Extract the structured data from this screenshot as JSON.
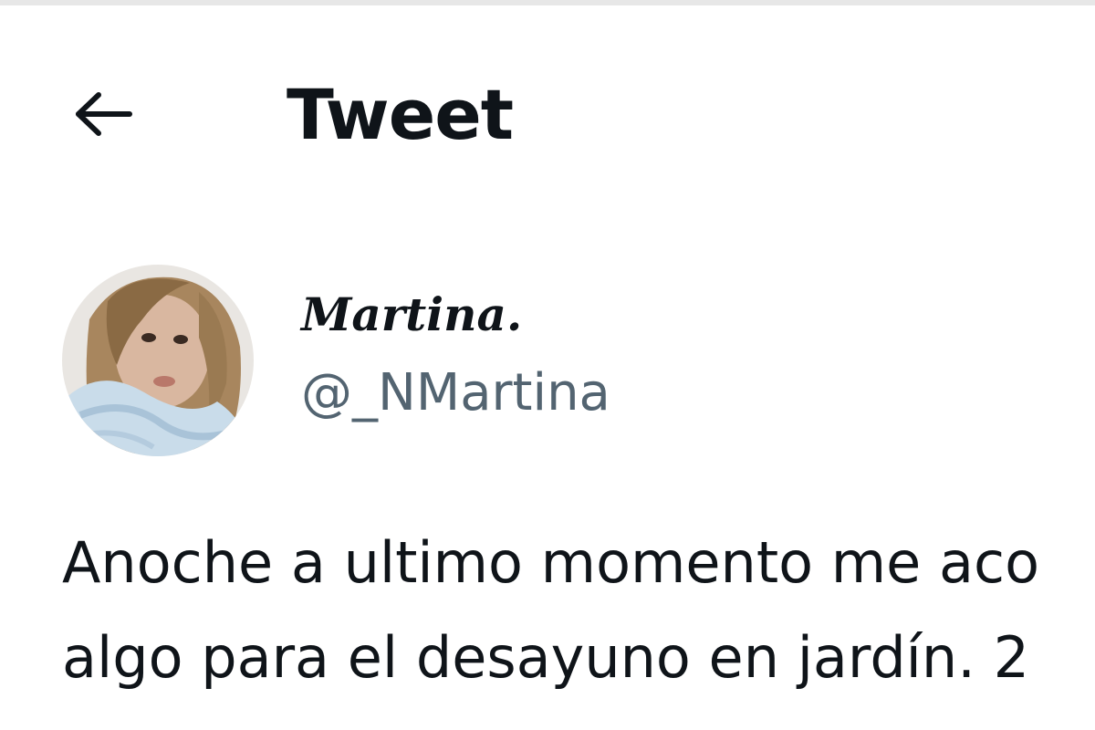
{
  "header": {
    "back_icon": "arrow-left-icon",
    "title": "Tweet"
  },
  "author": {
    "avatar": "profile-photo",
    "display_name": "Martina.",
    "handle": "@_NMartina"
  },
  "tweet": {
    "lines": [
      "Anoche a ultimo momento me aco",
      "algo para el desayuno en jardín. 2",
      ""
    ]
  },
  "colors": {
    "text_primary": "#0f1419",
    "text_secondary": "#536471",
    "background": "#ffffff"
  }
}
